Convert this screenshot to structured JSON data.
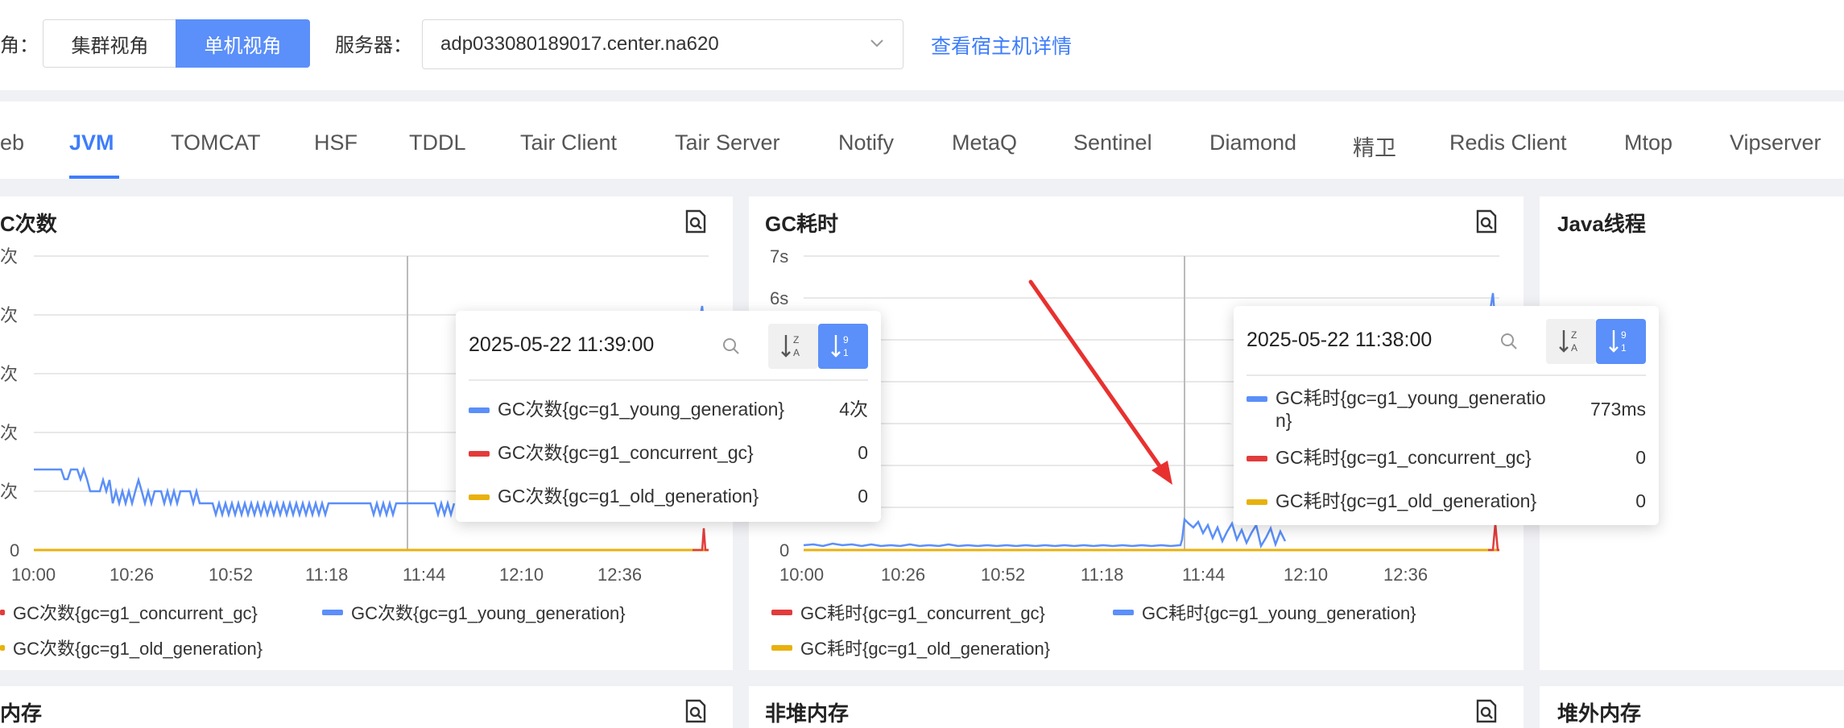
{
  "topbar": {
    "view_label": "角：",
    "seg_cluster": "集群视角",
    "seg_single": "单机视角",
    "server_label": "服务器：",
    "server_value": "adp033080189017.center.na620",
    "host_link": "查看宿主机详情"
  },
  "tabs": [
    {
      "label": "eb"
    },
    {
      "label": "JVM"
    },
    {
      "label": "TOMCAT"
    },
    {
      "label": "HSF"
    },
    {
      "label": "TDDL"
    },
    {
      "label": "Tair Client"
    },
    {
      "label": "Tair Server"
    },
    {
      "label": "Notify"
    },
    {
      "label": "MetaQ"
    },
    {
      "label": "Sentinel"
    },
    {
      "label": "Diamond"
    },
    {
      "label": "精卫"
    },
    {
      "label": "Redis Client"
    },
    {
      "label": "Mtop"
    },
    {
      "label": "Vipserver"
    }
  ],
  "panels": {
    "gc_count": {
      "title": "C次数",
      "y_ticks": [
        "次",
        "次",
        "次",
        "次",
        "次",
        "0"
      ],
      "x_ticks": [
        "10:00",
        "10:26",
        "10:52",
        "11:18",
        "11:44",
        "12:10",
        "12:36"
      ],
      "legend": [
        {
          "label": "GC次数{gc=g1_concurrent_gc}",
          "color": "#e23b3b"
        },
        {
          "label": "GC次数{gc=g1_young_generation}",
          "color": "#5b8ff9"
        },
        {
          "label": "GC次数{gc=g1_old_generation}",
          "color": "#e8b10e"
        }
      ],
      "tooltip": {
        "time": "2025-05-22 11:39:00",
        "rows": [
          {
            "name": "GC次数{gc=g1_young_generation}",
            "value": "4次",
            "color": "#5b8ff9"
          },
          {
            "name": "GC次数{gc=g1_concurrent_gc}",
            "value": "0",
            "color": "#e23b3b"
          },
          {
            "name": "GC次数{gc=g1_old_generation}",
            "value": "0",
            "color": "#e8b10e"
          }
        ]
      }
    },
    "gc_time": {
      "title": "GC耗时",
      "y_ticks": [
        "7s",
        "6s",
        "0"
      ],
      "x_ticks": [
        "10:00",
        "10:26",
        "10:52",
        "11:18",
        "11:44",
        "12:10",
        "12:36"
      ],
      "legend": [
        {
          "label": "GC耗时{gc=g1_concurrent_gc}",
          "color": "#e23b3b"
        },
        {
          "label": "GC耗时{gc=g1_young_generation}",
          "color": "#5b8ff9"
        },
        {
          "label": "GC耗时{gc=g1_old_generation}",
          "color": "#e8b10e"
        }
      ],
      "tooltip": {
        "time": "2025-05-22 11:38:00",
        "rows": [
          {
            "name": "GC耗时{gc=g1_young_generatio\nn}",
            "value": "773ms",
            "color": "#5b8ff9"
          },
          {
            "name": "GC耗时{gc=g1_concurrent_gc}",
            "value": "0",
            "color": "#e23b3b"
          },
          {
            "name": "GC耗时{gc=g1_old_generation}",
            "value": "0",
            "color": "#e8b10e"
          }
        ]
      }
    },
    "java_threads": {
      "title": "Java线程"
    },
    "bottom": {
      "heap": "内存",
      "nonheap": "非堆内存",
      "offheap": "堆外内存"
    }
  },
  "colors": {
    "accent": "#3e7dfb",
    "series_blue": "#5b8ff9",
    "series_red": "#e23b3b",
    "series_yellow": "#e8b10e",
    "annotation_arrow": "#e8312f"
  }
}
